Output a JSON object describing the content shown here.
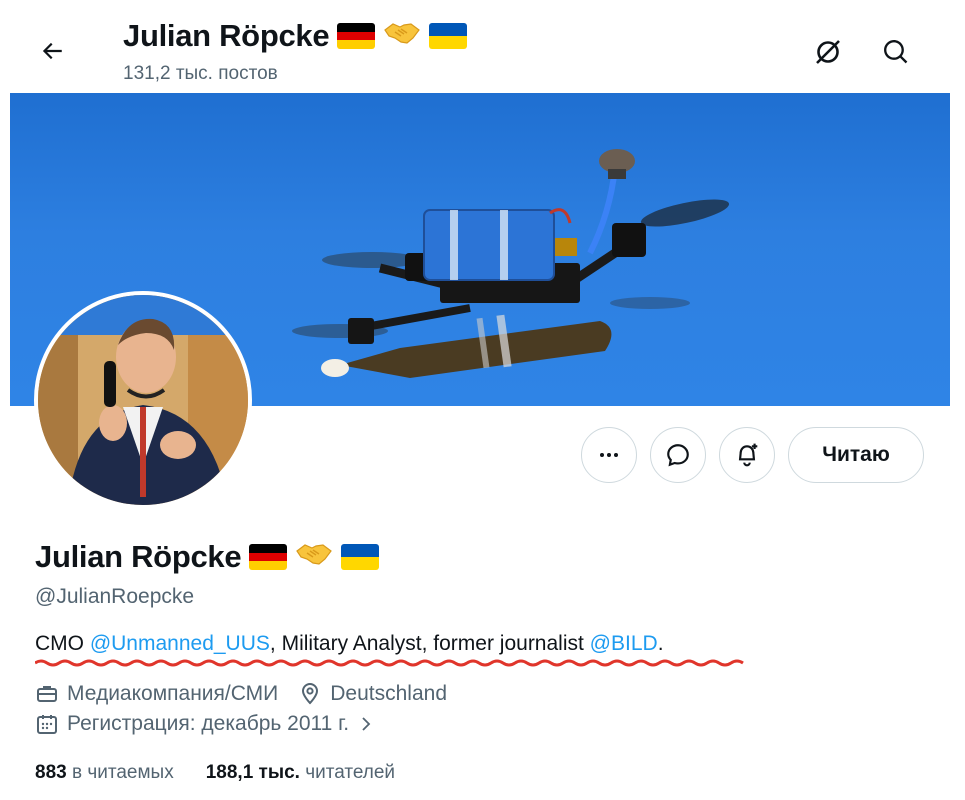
{
  "header": {
    "name": "Julian Röpcke",
    "post_count": "131,2 тыс. постов"
  },
  "profile": {
    "name": "Julian Röpcke",
    "handle": "@JulianRoepcke",
    "bio": {
      "prefix": "CMO ",
      "mention1": "@Unmanned_UUS",
      "middle": ", Military Analyst, former journalist ",
      "mention2": "@BILD",
      "suffix": "."
    },
    "category": "Медиакомпания/СМИ",
    "location": "Deutschland",
    "joined": "Регистрация: декабрь 2011 г."
  },
  "actions": {
    "follow_label": "Читаю"
  },
  "stats": {
    "following_count": "883",
    "following_label": "в читаемых",
    "followers_count": "188,1 тыс.",
    "followers_label": "читателей"
  },
  "icons": {
    "back": "arrow-left-icon",
    "grok": "grok-icon",
    "search": "search-icon",
    "more": "more-icon",
    "message": "message-icon",
    "notify": "bell-plus-icon",
    "briefcase": "briefcase-icon",
    "location": "location-icon",
    "calendar": "calendar-icon"
  },
  "colors": {
    "accent": "#1d9bf0",
    "secondary_text": "#536471",
    "primary_text": "#0f1419",
    "banner_sky": "#2d7fe0",
    "underline": "#e0352b"
  }
}
